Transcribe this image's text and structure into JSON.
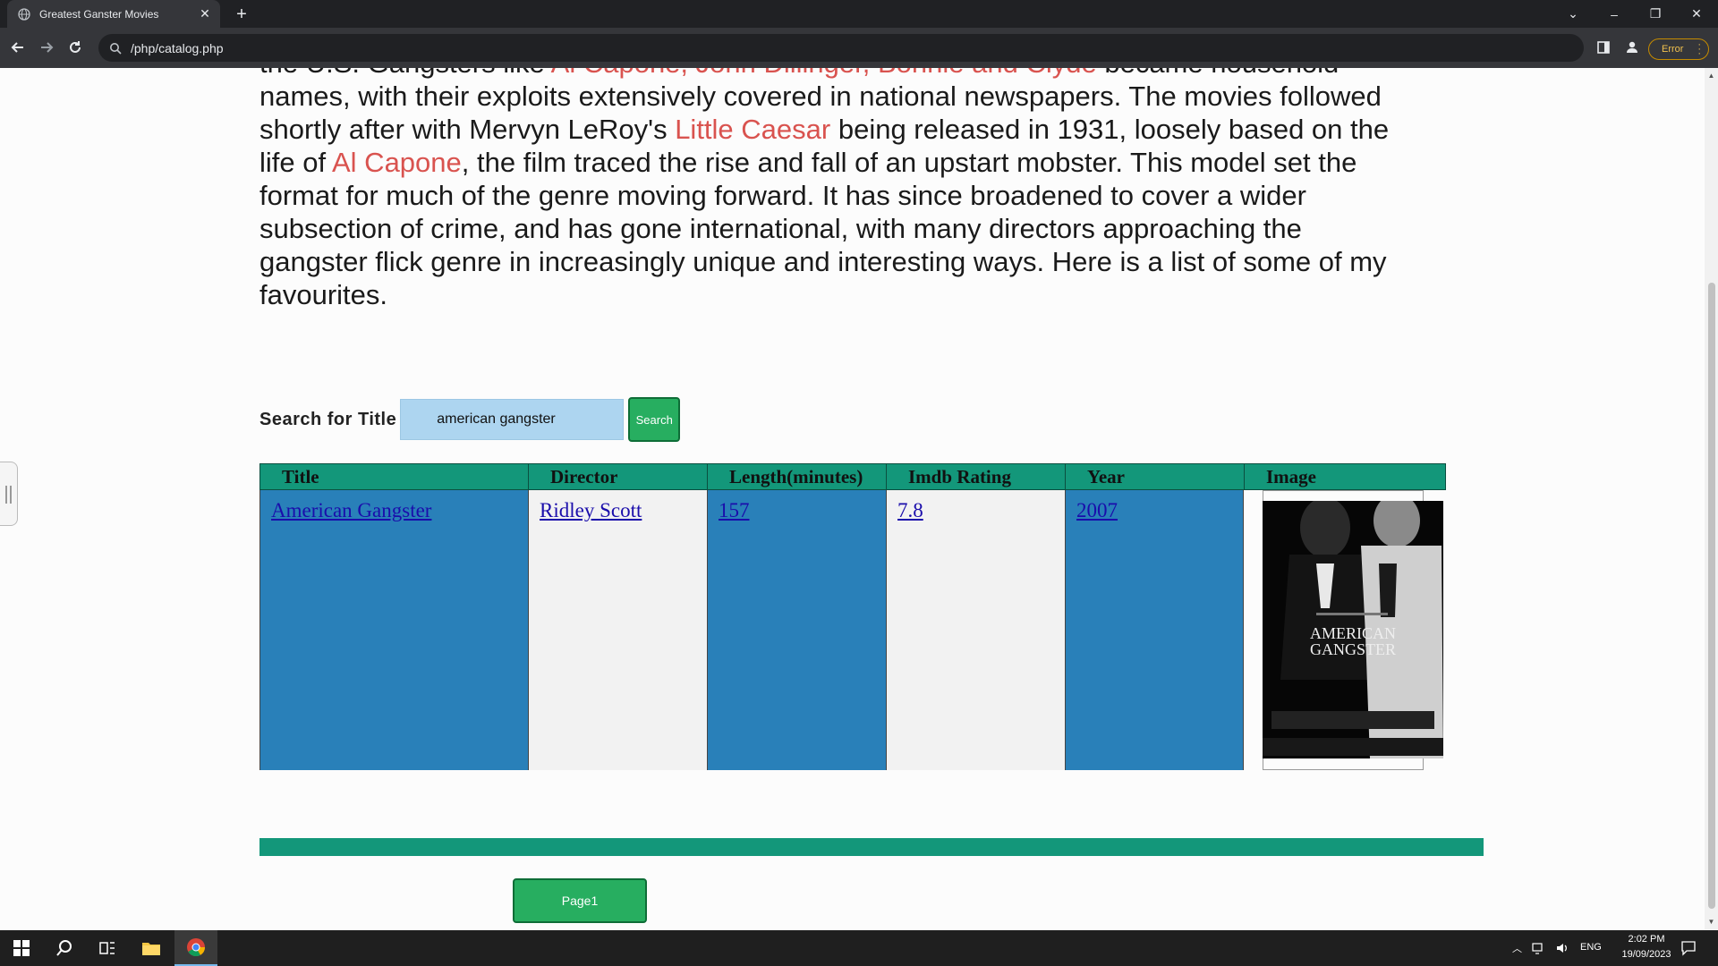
{
  "browser": {
    "tab_title": "Greatest Ganster Movies",
    "url": "/php/catalog.php",
    "status_pill": "Error"
  },
  "intro": {
    "line0_pre": "the U.S. Gangsters like ",
    "line0_hl": "Al Capone, John Dillinger, Bonnie and Clyde",
    "line0_post": " became household",
    "line1": "names, with their exploits extensively covered in national newspapers. The movies followed",
    "line2_pre": "shortly after with Mervyn LeRoy's ",
    "line2_hl": "Little Caesar",
    "line2_post": " being released in 1931, loosely based on the",
    "line3_pre": "life of ",
    "line3_hl": "Al Capone",
    "line3_post": ", the film traced the rise and fall of an upstart mobster. This model set the",
    "line4": "format for much of the genre moving forward. It has since broadened to cover a wider",
    "line5": "subsection of crime, and has gone international, with many directors approaching the",
    "line6": "gangster flick genre in increasingly unique and interesting ways. Here is a list of some of my",
    "line7": "favourites."
  },
  "search": {
    "label": "Search for Title",
    "value": "american gangster",
    "button": "Search"
  },
  "table": {
    "headers": [
      "Title",
      "Director",
      "Length(minutes)",
      "Imdb Rating",
      "Year",
      "Image"
    ],
    "row": {
      "title": "American Gangster",
      "director": "Ridley Scott",
      "length": "157",
      "rating": "7.8",
      "year": "2007"
    },
    "poster": {
      "line1": "AMERICAN",
      "line2": "GANGSTER"
    }
  },
  "pagination": {
    "button": "Page1"
  },
  "taskbar": {
    "lang": "ENG",
    "time": "2:02 PM",
    "date": "19/09/2023"
  },
  "colors": {
    "header_green": "#13977a",
    "cell_blue": "#2980b9",
    "button_green": "#27ae60",
    "highlight_red": "#d9534f"
  }
}
